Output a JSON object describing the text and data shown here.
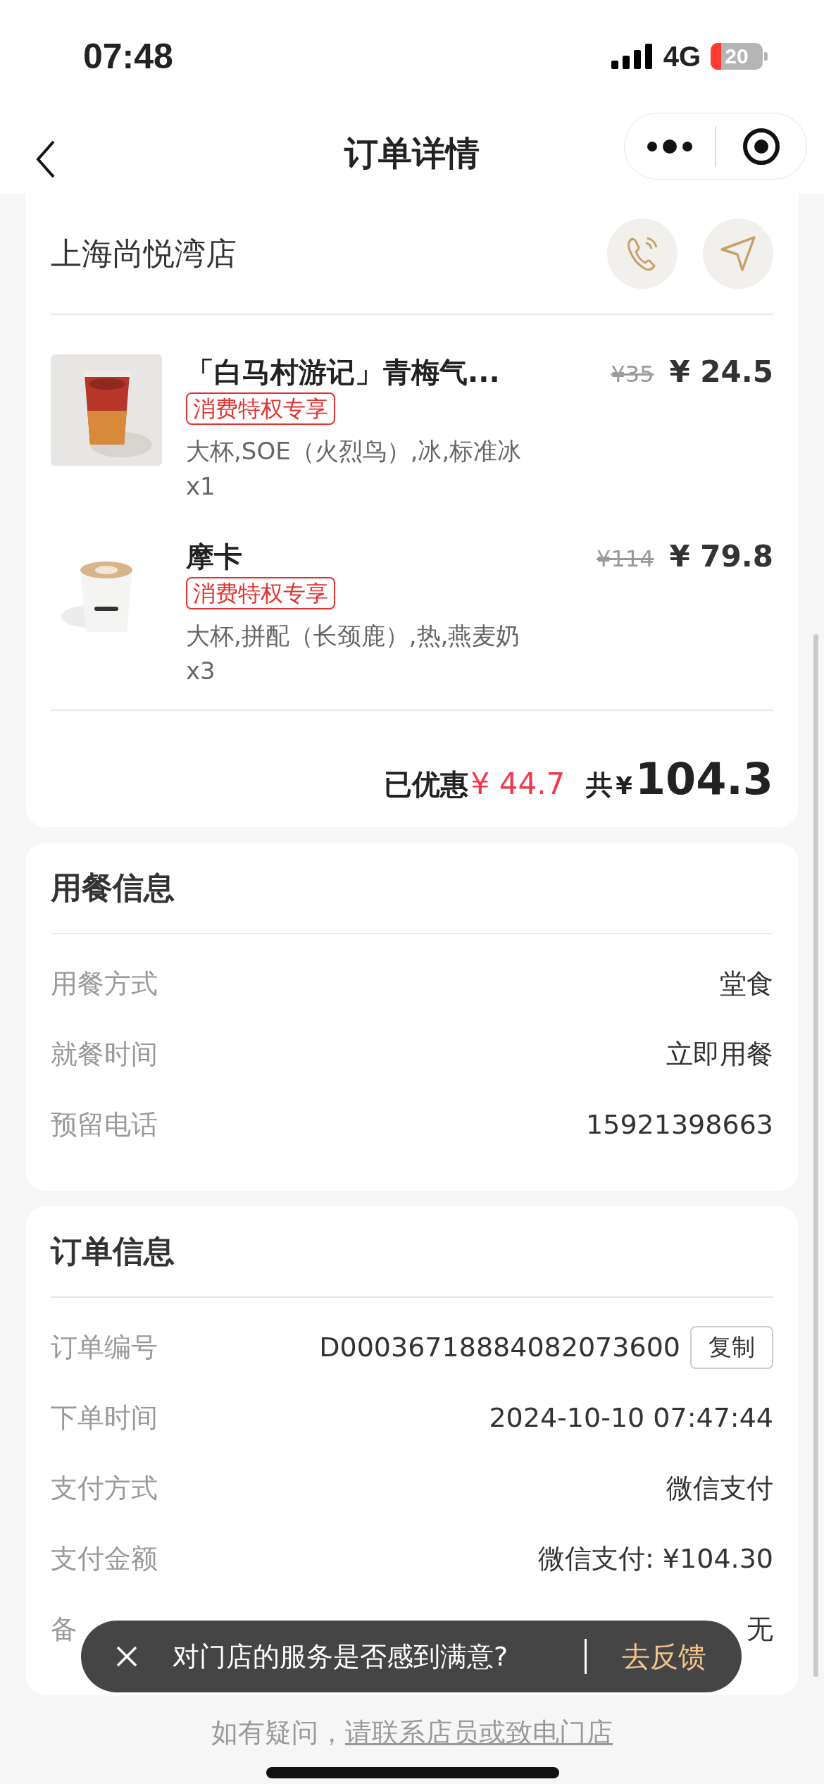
{
  "status_bar": {
    "time": "07:48",
    "network": "4G",
    "battery": "20"
  },
  "nav": {
    "title": "订单详情"
  },
  "store": {
    "name": "上海尚悦湾店"
  },
  "items": [
    {
      "name": "「白马村游记」青梅气...",
      "tag": "消费特权专享",
      "specs": "大杯,SOE（火烈鸟）,冰,标准冰",
      "qty": "x1",
      "original_price": "¥35",
      "price": "¥ 24.5",
      "kind": "iced"
    },
    {
      "name": "摩卡",
      "tag": "消费特权专享",
      "specs": "大杯,拼配（长颈鹿）,热,燕麦奶",
      "qty": "x3",
      "original_price": "¥114",
      "price": "¥ 79.8",
      "kind": "hot"
    }
  ],
  "summary": {
    "discount_label": "已优惠",
    "discount": "¥ 44.7",
    "total_label": "共",
    "currency": "¥",
    "total": "104.3"
  },
  "dining": {
    "title": "用餐信息",
    "rows": [
      {
        "label": "用餐方式",
        "value": "堂食"
      },
      {
        "label": "就餐时间",
        "value": "立即用餐"
      },
      {
        "label": "预留电话",
        "value": "15921398663"
      }
    ]
  },
  "order": {
    "title": "订单信息",
    "rows": [
      {
        "label": "订单编号",
        "value": "D00036718884082073600",
        "action": "复制"
      },
      {
        "label": "下单时间",
        "value": "2024-10-10 07:47:44"
      },
      {
        "label": "支付方式",
        "value": "微信支付"
      },
      {
        "label": "支付金额",
        "value": "微信支付: ¥104.30"
      },
      {
        "label": "备",
        "value": "无"
      }
    ]
  },
  "footer": {
    "text": "如有疑问，",
    "link": "请联系店员或致电门店"
  },
  "toast": {
    "message": "对门店的服务是否感到满意?",
    "action": "去反馈"
  }
}
